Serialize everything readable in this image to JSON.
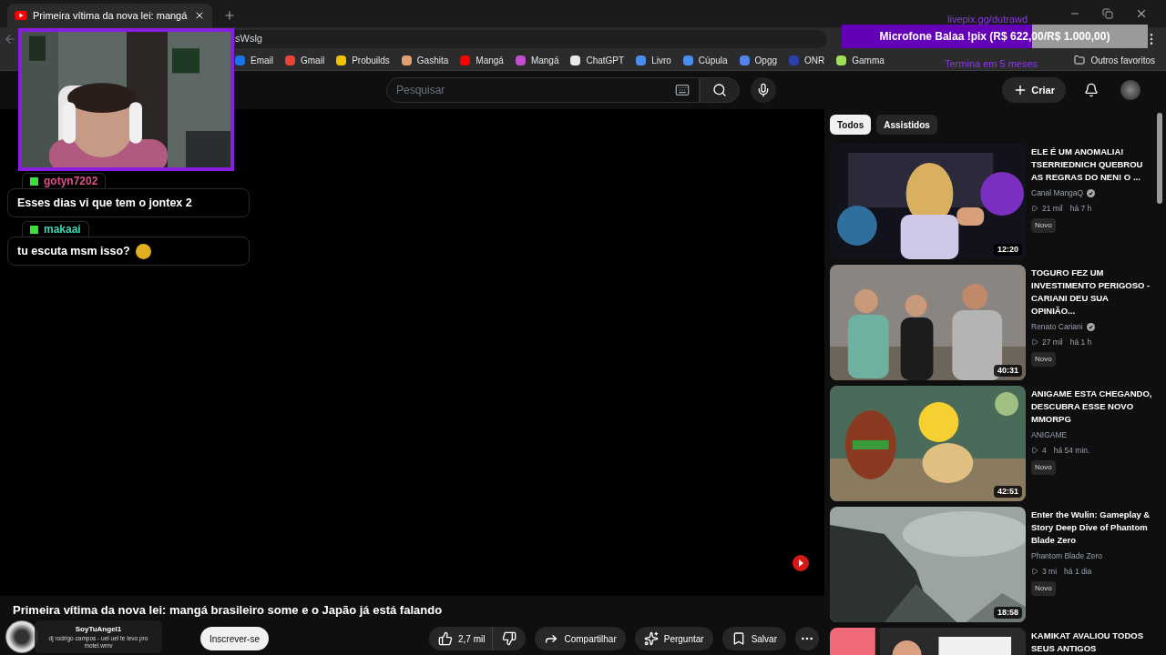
{
  "browser": {
    "tab": {
      "title": "Primeira vítima da nova lei: mangá",
      "selected": true
    },
    "address": "sWslg",
    "bookmarks": [
      {
        "label": "Email",
        "color": "#1a73e8"
      },
      {
        "label": "Gmail",
        "color": "#ea4335"
      },
      {
        "label": "Probuilds",
        "color": "#f2c200"
      },
      {
        "label": "Gashita",
        "color": "#e0a070"
      },
      {
        "label": "Mangá",
        "color": "#ff0000"
      },
      {
        "label": "Mangá",
        "color": "#c04fd0"
      },
      {
        "label": "ChatGPT",
        "color": "#e8e8e8"
      },
      {
        "label": "Livro",
        "color": "#4a8ff0"
      },
      {
        "label": "Cúpula",
        "color": "#4a8ff0"
      },
      {
        "label": "Opgg",
        "color": "#5383e8"
      },
      {
        "label": "ONR",
        "color": "#2a3fa8"
      },
      {
        "label": "Gamma",
        "color": "#9de05a"
      }
    ],
    "other_bookmarks": "Outros favoritos"
  },
  "goal_overlay": {
    "link": "livepix.gg/dutrawd",
    "title": "Microfone Balaa !pix (R$ 622,00/R$ 1.000,00)",
    "level": 0.622,
    "ends": "Termina em 5 meses"
  },
  "header": {
    "search": {
      "placeholder": "Pesquisar"
    },
    "create": "Criar"
  },
  "chat": [
    {
      "user": "gotyn7202",
      "color": "#e0508a",
      "message": "Esses dias vi que tem o jontex 2",
      "emote": false
    },
    {
      "user": "makaai",
      "color": "#3dd6b4",
      "message": "tu escuta msm isso?",
      "emote": true
    }
  ],
  "video": {
    "title": "Primeira vítima da nova lei: mangá brasileiro some e o Japão já está falando",
    "subscribe": "Inscrever-se",
    "likes": "2,7 mil",
    "share": "Compartilhar",
    "ask": "Perguntar",
    "save": "Salvar"
  },
  "alert": {
    "user": "SoyTuAngel1",
    "message": "dj rodrigo campos - uel uel te levo pro motel.wmv"
  },
  "sidebar": {
    "chips": [
      {
        "label": "Todos",
        "selected": true
      },
      {
        "label": "Assistidos",
        "selected": false
      }
    ],
    "videos": [
      {
        "title": "ELE É UM ANOMALIA! TSERRIEDNICH QUEBROU AS REGRAS DO NEN! O ...",
        "channel": "Canal MangaQ",
        "verified": true,
        "views": "21 mil",
        "age": "há 7 h",
        "badge": "Novo",
        "duration": "12:20"
      },
      {
        "title": "TOGURO FEZ UM INVESTIMENTO PERIGOSO - CARIANI DEU SUA OPINIÃO...",
        "channel": "Renato Cariani",
        "verified": true,
        "views": "27 mil",
        "age": "há 1 h",
        "badge": "Novo",
        "duration": "40:31"
      },
      {
        "title": "ANIGAME ESTA CHEGANDO, DESCUBRA ESSE NOVO MMORPG",
        "channel": "ANIGAME",
        "verified": false,
        "views": "4",
        "age": "há 54 min.",
        "badge": "Novo",
        "duration": "42:51"
      },
      {
        "title": "Enter the Wulin: Gameplay & Story Deep Dive of Phantom Blade Zero",
        "channel": "Phantom Blade Zero",
        "verified": false,
        "views": "3 mi",
        "age": "há 1 dia",
        "badge": "Novo",
        "duration": "18:58"
      },
      {
        "title": "KAMIKAT AVALIOU TODOS SEUS ANTIGOS"
      }
    ]
  }
}
